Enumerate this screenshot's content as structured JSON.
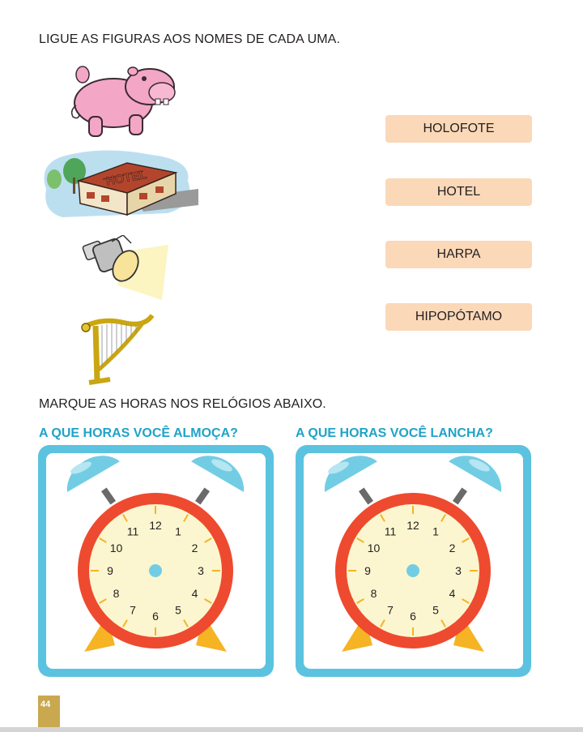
{
  "instructions": {
    "match": "LIGUE AS FIGURAS AOS NOMES DE CADA UMA.",
    "clocks": "MARQUE AS HORAS NOS RELÓGIOS ABAIXO."
  },
  "pictures": [
    {
      "name": "hippo",
      "icon": "hippo-icon"
    },
    {
      "name": "hotel",
      "icon": "hotel-icon",
      "sign": "HOTEL"
    },
    {
      "name": "spotlight",
      "icon": "spotlight-icon"
    },
    {
      "name": "harp",
      "icon": "harp-icon"
    }
  ],
  "words": [
    "HOLOFOTE",
    "HOTEL",
    "HARPA",
    "HIPOPÓTAMO"
  ],
  "questions": {
    "lunch": "A QUE HORAS VOCÊ ALMOÇA?",
    "snack": "A QUE HORAS VOCÊ LANCHA?"
  },
  "clock_numbers": [
    "12",
    "1",
    "2",
    "3",
    "4",
    "5",
    "6",
    "7",
    "8",
    "9",
    "10",
    "11"
  ],
  "page_number": "44",
  "colors": {
    "word_box": "#fbd8b8",
    "question_text": "#1fa3c8",
    "panel": "#5bc3df",
    "clock_rim": "#ee4a2f",
    "clock_face": "#fbf6cf",
    "bell": "#72cde4",
    "feet": "#f6b323",
    "page_box": "#c9a84f"
  }
}
